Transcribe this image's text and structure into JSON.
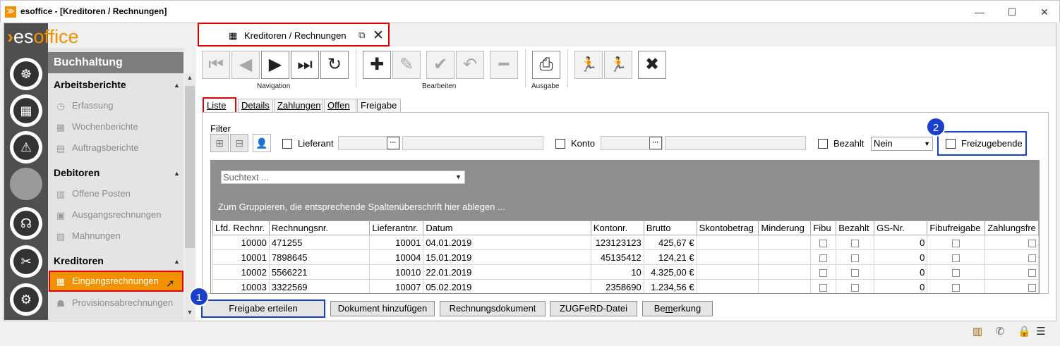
{
  "window": {
    "title": "esoffice - [Kreditoren / Rechnungen]",
    "controls": {
      "minimize": "—",
      "maximize": "☐",
      "close": "✕"
    }
  },
  "logo": {
    "chevron": "›",
    "text_es": "es",
    "text_office": "office"
  },
  "nav": {
    "header": "Buchhaltung",
    "sections": [
      {
        "title": "Arbeitsberichte",
        "items": [
          {
            "label": "Erfassung",
            "icon": "clock-doc-icon"
          },
          {
            "label": "Wochenberichte",
            "icon": "calendar-icon"
          },
          {
            "label": "Auftragsberichte",
            "icon": "report-icon"
          }
        ]
      },
      {
        "title": "Debitoren",
        "items": [
          {
            "label": "Offene Posten",
            "icon": "doc-icon"
          },
          {
            "label": "Ausgangsrechnungen",
            "icon": "money-icon"
          },
          {
            "label": "Mahnungen",
            "icon": "warning-doc-icon"
          }
        ]
      },
      {
        "title": "Kreditoren",
        "items": [
          {
            "label": "Eingangsrechnungen",
            "icon": "invoice-icon",
            "active": true
          },
          {
            "label": "Provisionsabrechnungen",
            "icon": "person-doc-icon"
          }
        ]
      }
    ],
    "collapse_glyph": "▲"
  },
  "doc_tab": {
    "label": "Kreditoren / Rechnungen",
    "ext_glyph": "⧉",
    "close_glyph": "✕",
    "icon_glyph": "▦"
  },
  "toolbar": {
    "groups": [
      "Navigation",
      "Bearbeiten",
      "Ausgabe"
    ],
    "glyphs": {
      "first": "⏮",
      "prev": "◀",
      "next": "▶",
      "last": "⏭",
      "refresh": "↻",
      "add": "✚",
      "edit": "✎",
      "confirm": "✔",
      "undo": "↶",
      "remove": "━",
      "print": "⎙",
      "run1": "🏃",
      "run2": "🏃",
      "cancel": "✖"
    }
  },
  "tabs": [
    "Liste",
    "Details",
    "Zahlungen",
    "Offen",
    "Freigabe"
  ],
  "filter": {
    "label": "Filter",
    "lieferant": "Lieferant",
    "konto": "Konto",
    "bezahlt": "Bezahlt",
    "bezahlt_value": "Nein",
    "freizugebende": "Freizugebende",
    "dots": "···"
  },
  "badges": [
    "1",
    "2"
  ],
  "grid": {
    "search_placeholder": "Suchtext ...",
    "group_hint": "Zum Gruppieren, die entsprechende Spaltenüberschrift hier ablegen ...",
    "columns": [
      "Lfd. Rechnr.",
      "Rechnungsnr.",
      "Lieferantnr.",
      "Datum",
      "Kontonr.",
      "Brutto",
      "Skontobetrag",
      "Minderung",
      "Fibu",
      "Bezahlt",
      "GS-Nr.",
      "Fibufreigabe",
      "Zahlungsfre"
    ],
    "rows": [
      {
        "lfd": "10000",
        "rechnr": "471255",
        "liefnr": "10001",
        "datum": "04.01.2019",
        "konto": "123123123",
        "brutto": "425,67 €",
        "gs": "0"
      },
      {
        "lfd": "10001",
        "rechnr": "7898645",
        "liefnr": "10004",
        "datum": "15.01.2019",
        "konto": "45135412",
        "brutto": "124,21 €",
        "gs": "0"
      },
      {
        "lfd": "10002",
        "rechnr": "5566221",
        "liefnr": "10010",
        "datum": "22.01.2019",
        "konto": "10",
        "brutto": "4.325,00 €",
        "gs": "0"
      },
      {
        "lfd": "10003",
        "rechnr": "3322569",
        "liefnr": "10007",
        "datum": "05.02.2019",
        "konto": "2358690",
        "brutto": "1.234,56 €",
        "gs": "0"
      }
    ]
  },
  "buttons": {
    "freigabe": "Freigabe erteilen",
    "dokument": "Dokument hinzufügen",
    "rechnungsdokument": "Rechnungsdokument",
    "zugferd": "ZUGFeRD-Datei",
    "bemerkung_pre": "Be",
    "bemerkung_u": "m",
    "bemerkung_post": "erkung"
  },
  "colors": {
    "accent": "#f39200",
    "highlight_red": "#e00000",
    "highlight_blue": "#1a3fcc",
    "sidebar": "#4f4f4f"
  }
}
